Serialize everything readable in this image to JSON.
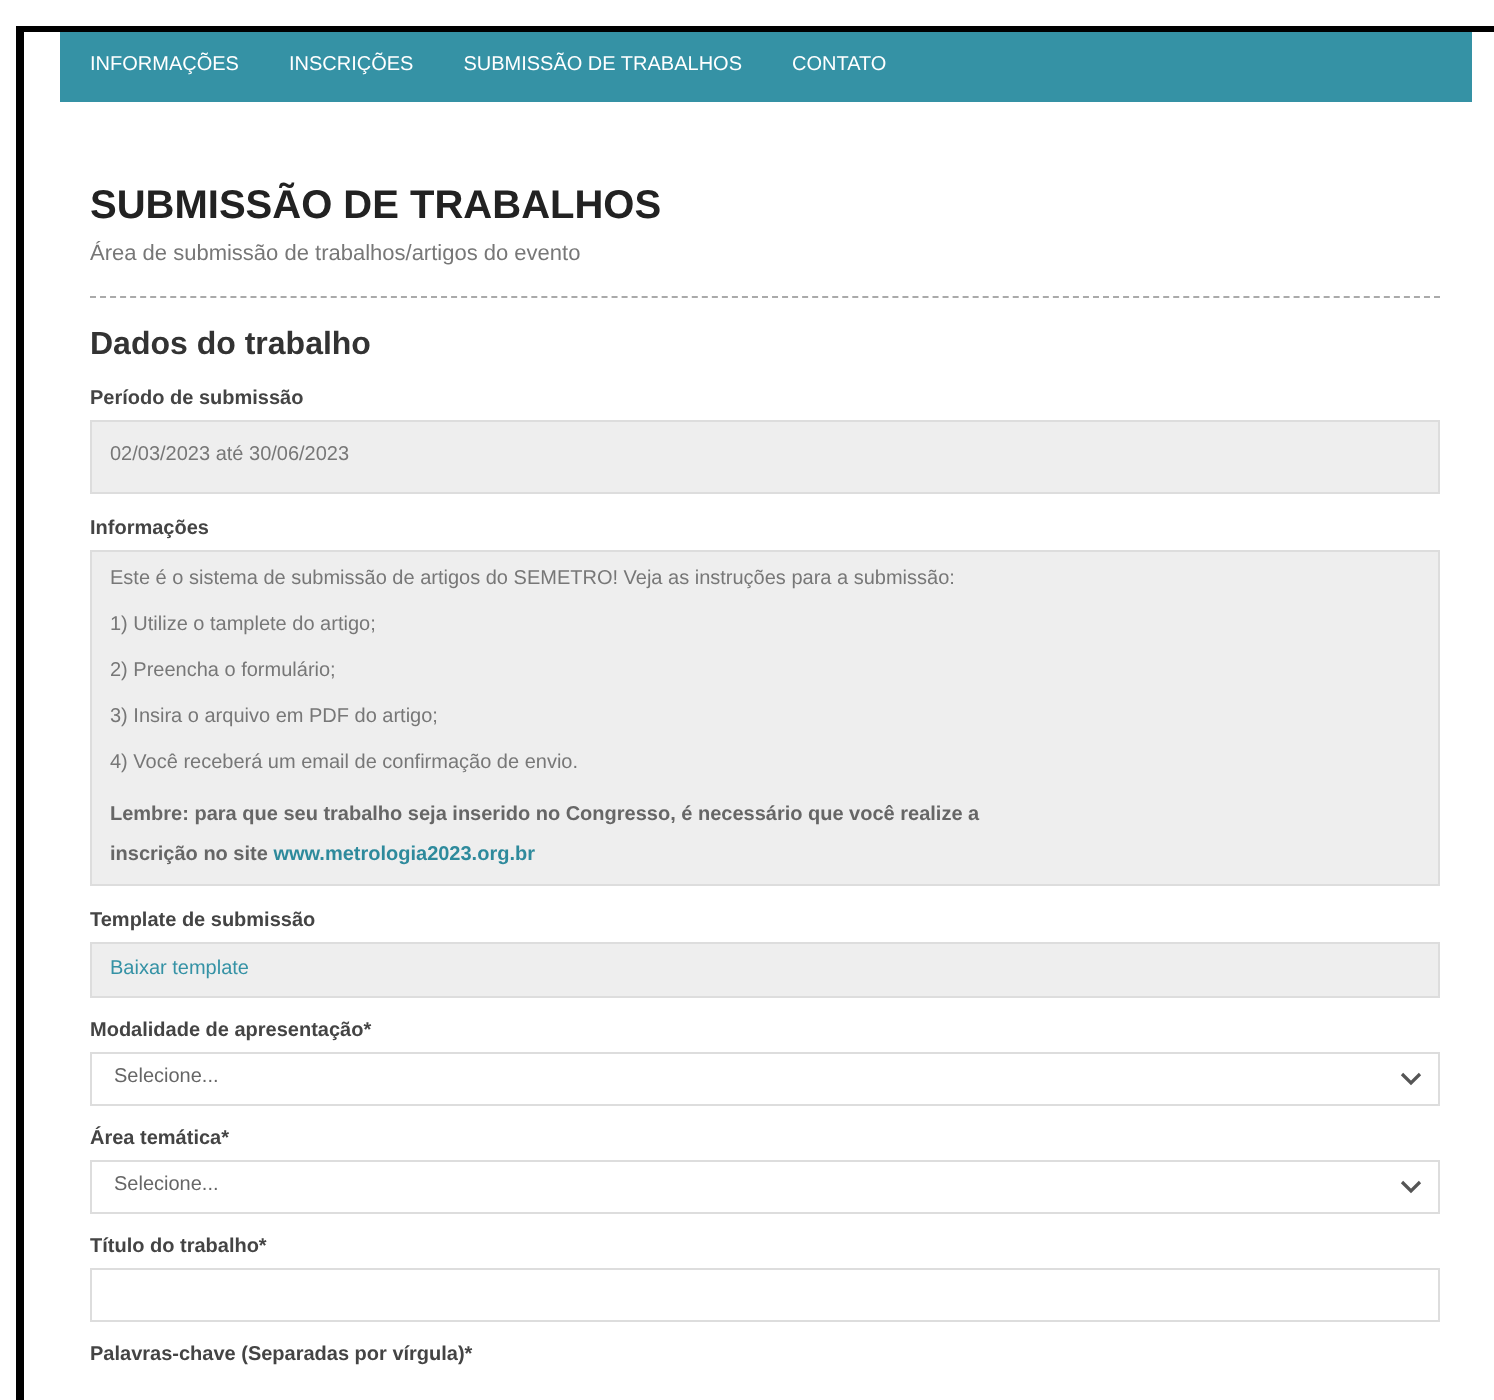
{
  "nav": [
    "INFORMAÇÕES",
    "INSCRIÇÕES",
    "SUBMISSÃO DE TRABALHOS",
    "CONTATO"
  ],
  "page": {
    "title": "SUBMISSÃO DE TRABALHOS",
    "subtitle": "Área de submissão de trabalhos/artigos do evento"
  },
  "section": "Dados do trabalho",
  "fields": [
    {
      "kind": "static",
      "label": "Período de submissão",
      "value": "02/03/2023 até 30/06/2023"
    },
    {
      "kind": "info",
      "label": "Informações",
      "lines": [
        "Este é o sistema de submissão de artigos do SEMETRO! Veja as instruções para a submissão:",
        "1) Utilize o tamplete do artigo;",
        "2) Preencha o formulário;",
        "3) Insira o arquivo em PDF do artigo;",
        "4) Você receberá um email de confirmação de envio."
      ],
      "note": {
        "text": "Lembre: para que seu trabalho seja inserido no Congresso, é necessário que você realize a inscrição no site",
        "link": "www.metrologia2023.org.br"
      }
    },
    {
      "kind": "link",
      "label": "Template de submissão",
      "value": "Baixar template"
    },
    {
      "kind": "select",
      "label": "Modalidade de apresentação*",
      "value": "Selecione..."
    },
    {
      "kind": "select",
      "label": "Área temática*",
      "value": "Selecione..."
    },
    {
      "kind": "input",
      "label": "Título do trabalho*"
    },
    {
      "kind": "none",
      "label": "Palavras-chave (Separadas por vírgula)*"
    }
  ]
}
